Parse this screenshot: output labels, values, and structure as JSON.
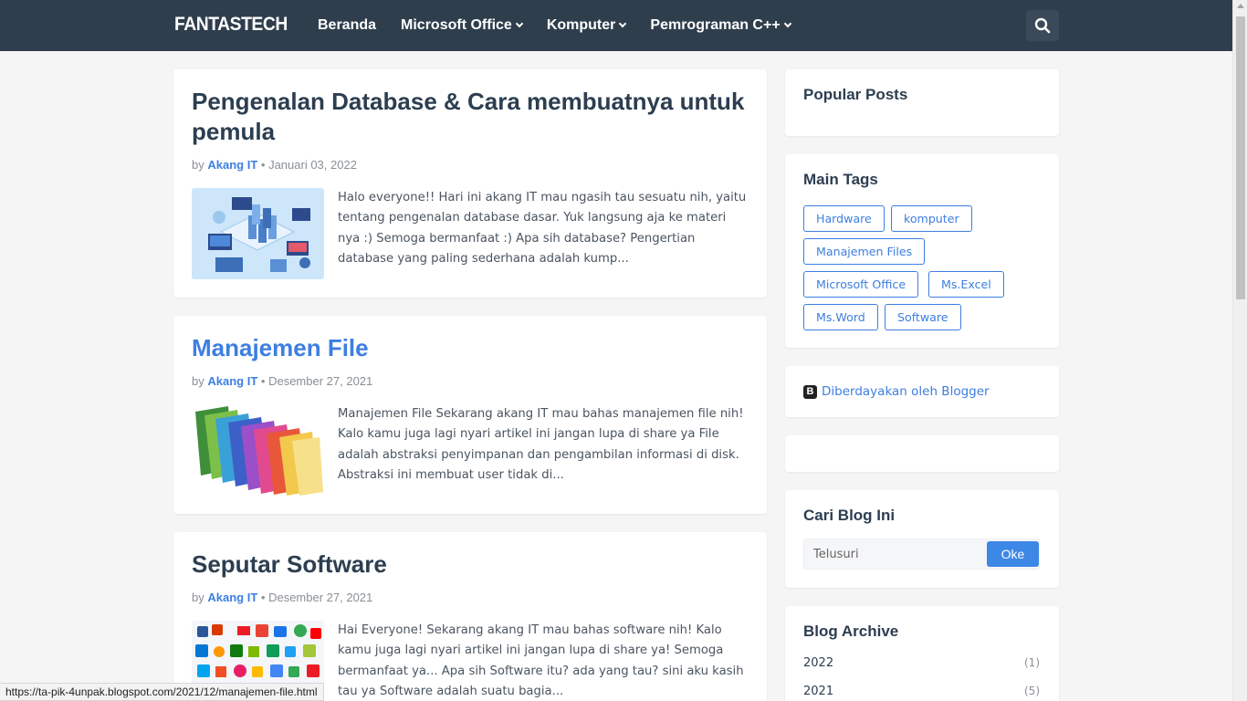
{
  "header": {
    "logo": "FANTASTECH",
    "nav": [
      {
        "label": "Beranda"
      },
      {
        "label": "Microsoft Office"
      },
      {
        "label": "Komputer"
      },
      {
        "label": "Pemrograman C++"
      }
    ]
  },
  "posts": [
    {
      "title": "Pengenalan Database & Cara membuatnya untuk pemula",
      "by": "by",
      "author": "Akang IT",
      "sep": "•",
      "date": "Januari 03, 2022",
      "excerpt": "Halo everyone!! Hari ini akang IT mau ngasih tau sesuatu nih, yaitu tentang pengenalan database dasar. Yuk langsung aja ke materi nya :) Semoga bermanfaat :) Apa sih database? Pengertian database yang paling sederhana adalah kump..."
    },
    {
      "title": "Manajemen File",
      "by": "by",
      "author": "Akang IT",
      "sep": "•",
      "date": "Desember 27, 2021",
      "excerpt": "Manajemen File Sekarang akang IT mau bahas manajemen file nih! Kalo kamu juga lagi nyari artikel ini jangan lupa di share ya File adalah abstraksi penyimpanan dan pengambilan informasi di disk. Abstraksi ini membuat user tidak di..."
    },
    {
      "title": "Seputar Software",
      "by": "by",
      "author": "Akang IT",
      "sep": "•",
      "date": "Desember 27, 2021",
      "excerpt": "Hai Everyone! Sekarang akang IT mau bahas software nih! Kalo kamu juga lagi nyari artikel ini jangan lupa di share ya! Semoga bermanfaat ya... Apa sih Software itu? ada yang tau? sini aku kasih tau ya Software adalah suatu bagia..."
    }
  ],
  "sidebar": {
    "popular_title": "Popular Posts",
    "tags_title": "Main Tags",
    "tags": [
      "Hardware",
      "komputer",
      "Manajemen Files",
      "Microsoft Office",
      "Ms.Excel",
      "Ms.Word",
      "Software"
    ],
    "powered_text": "Diberdayakan oleh Blogger",
    "search_title": "Cari Blog Ini",
    "search_placeholder": "Telusuri",
    "search_button": "Oke",
    "archive_title": "Blog Archive",
    "archive": [
      {
        "year": "2022",
        "count": "(1)"
      },
      {
        "year": "2021",
        "count": "(5)"
      }
    ]
  },
  "status_url": "https://ta-pik-4unpak.blogspot.com/2021/12/manajemen-file.html",
  "colors": {
    "header_bg": "#2f3e4c",
    "accent": "#3d7ee1",
    "page_bg": "#f5f5f5"
  }
}
